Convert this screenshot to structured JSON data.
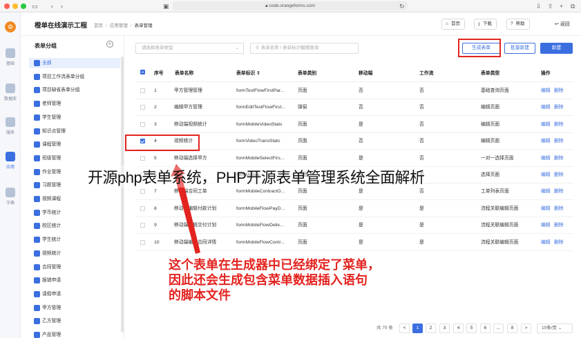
{
  "browser": {
    "url": "code.orangeforms.com"
  },
  "rail": {
    "logo": "⚙",
    "items": [
      {
        "label": "基础"
      },
      {
        "label": "数据库"
      },
      {
        "label": "服务"
      },
      {
        "label": "应用"
      },
      {
        "label": "字典"
      }
    ]
  },
  "header": {
    "title": "橙单在线演示工程",
    "breadcrumb": [
      "首页",
      "应用管理",
      "表单管理"
    ],
    "buttons": {
      "home": "首页",
      "download": "下载",
      "help": "帮助",
      "back": "返回"
    }
  },
  "groups": {
    "title": "表单分组",
    "add": "+",
    "items": [
      "全部",
      "项目工作流表单分组",
      "项目缺省表单分组",
      "老师管理",
      "学生管理",
      "知识点管理",
      "课程管理",
      "班级管理",
      "作业管理",
      "习题管理",
      "视频课程",
      "学币统计",
      "校区统计",
      "学生统计",
      "视频统计",
      "合同管理",
      "报销申请",
      "请假申请",
      "甲方管理",
      "乙方管理",
      "产品管理"
    ]
  },
  "toolbar": {
    "type_placeholder": "请选择表单类型",
    "search_placeholder": "表单名称 / 表单标识模糊查询",
    "generate": "生成表单",
    "batch_new": "批量新建",
    "new": "新建"
  },
  "table": {
    "columns": [
      "序号",
      "表单名称",
      "表单标识",
      "表单类别",
      "移动端",
      "工作流",
      "表单类型",
      "操作"
    ],
    "edit_label": "编辑",
    "delete_label": "删除",
    "rows": [
      {
        "no": "1",
        "name": "甲方管理管理",
        "key": "formTestFlowFirstPar...",
        "category": "页面",
        "mobile": "否",
        "flow": "否",
        "type": "基础查询页面",
        "checked": false
      },
      {
        "no": "2",
        "name": "编辑甲方管理",
        "key": "formEditTestFlowFirst...",
        "category": "弹窗",
        "mobile": "否",
        "flow": "否",
        "type": "编辑页面",
        "checked": false
      },
      {
        "no": "3",
        "name": "移动端视频统计",
        "key": "formMobileVideoStats",
        "category": "页面",
        "mobile": "是",
        "flow": "否",
        "type": "编辑页面",
        "checked": false
      },
      {
        "no": "4",
        "name": "视频统计",
        "key": "formVideoTransStats",
        "category": "页面",
        "mobile": "否",
        "flow": "否",
        "type": "编辑页面",
        "checked": true
      },
      {
        "no": "5",
        "name": "移动端选择甲方",
        "key": "formMobileSelectFirs...",
        "category": "页面",
        "mobile": "是",
        "flow": "否",
        "type": "一对一选择页面",
        "checked": false
      },
      {
        "no": "6",
        "name": "",
        "key": "formMobile...",
        "category": "页面",
        "mobile": "是",
        "flow": "否",
        "type": "选择页面",
        "checked": false
      },
      {
        "no": "7",
        "name": "移动端合同工单",
        "key": "formMobileContractO...",
        "category": "页面",
        "mobile": "是",
        "flow": "否",
        "type": "工单列表页面",
        "checked": false
      },
      {
        "no": "8",
        "name": "移动端编辑付款计划",
        "key": "formMobileFlowPayD...",
        "category": "页面",
        "mobile": "是",
        "flow": "是",
        "type": "流程关联编辑页面",
        "checked": false
      },
      {
        "no": "9",
        "name": "移动端编辑交付计划",
        "key": "formMobileFlowDeliv...",
        "category": "页面",
        "mobile": "是",
        "flow": "是",
        "type": "流程关联编辑页面",
        "checked": false
      },
      {
        "no": "10",
        "name": "移动端编辑合同详情",
        "key": "formMobileFlowContr...",
        "category": "页面",
        "mobile": "是",
        "flow": "是",
        "type": "流程关联编辑页面",
        "checked": false
      }
    ]
  },
  "pagination": {
    "total": "共 79 条",
    "prev": "<",
    "pages": [
      "1",
      "2",
      "3",
      "4",
      "5",
      "6",
      "...",
      "8"
    ],
    "next": ">",
    "page_size": "10条/页"
  },
  "overlay": {
    "title": "开源php表单系统，PHP开源表单管理系统全面解析",
    "note_lines": [
      "这个表单在生成器中已经绑定了菜单，",
      "因此还会生成包含菜单数据插入语句",
      "的脚本文件"
    ]
  },
  "colors": {
    "accent": "#3b6fe0",
    "annotation": "#e3231f",
    "logo": "#f08a24"
  }
}
